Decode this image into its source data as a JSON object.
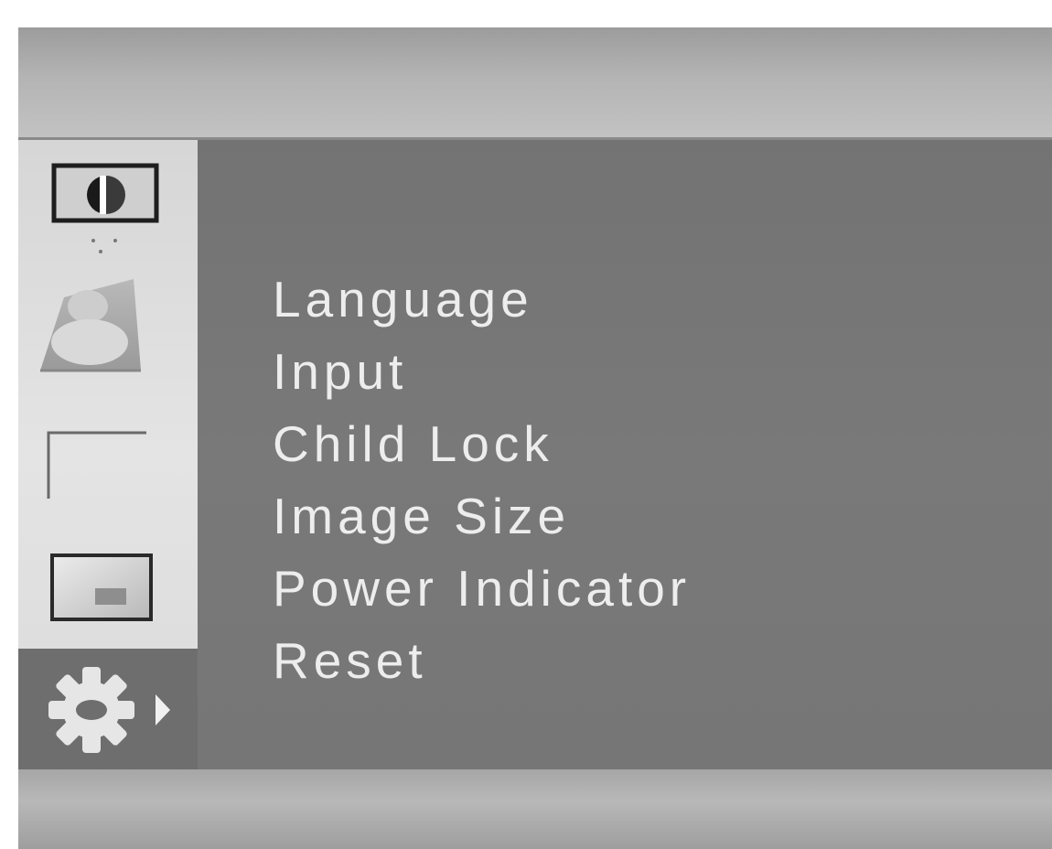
{
  "sidebar": {
    "items": [
      {
        "icon": "picture-adjust-icon"
      },
      {
        "icon": "color-icon"
      },
      {
        "icon": "tracking-icon"
      },
      {
        "icon": "setup-window-icon"
      },
      {
        "icon": "gear-icon",
        "selected": true
      }
    ]
  },
  "menu": {
    "items": [
      {
        "label": "Language"
      },
      {
        "label": "Input"
      },
      {
        "label": "Child Lock"
      },
      {
        "label": "Image Size"
      },
      {
        "label": "Power Indicator"
      },
      {
        "label": "Reset"
      }
    ]
  }
}
